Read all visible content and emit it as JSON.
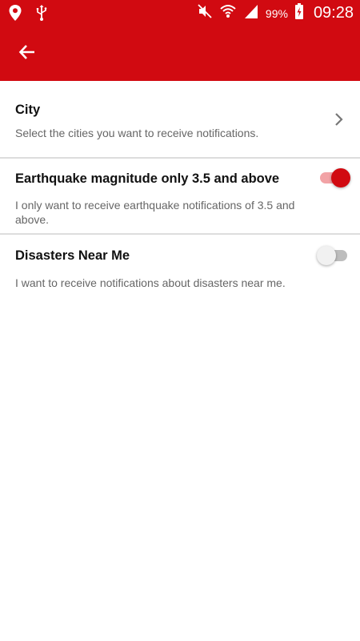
{
  "status_bar": {
    "battery_percent": "99%",
    "time": "09:28",
    "icons": [
      "location-icon",
      "usb-icon",
      "mute-icon",
      "wifi-icon",
      "signal-icon",
      "battery-charging-icon"
    ]
  },
  "app_bar": {
    "back_icon": "back-arrow-icon"
  },
  "settings": [
    {
      "title": "City",
      "summary": "Select the cities you want to receive notifications.",
      "control": "chevron-right-icon"
    },
    {
      "title": "Earthquake magnitude only 3.5 and above",
      "summary": "I only want to receive earthquake notifications of 3.5 and above.",
      "control": "switch",
      "enabled": true
    },
    {
      "title": "Disasters Near Me",
      "summary": "I want to receive notifications about disasters near me.",
      "control": "switch",
      "enabled": false
    }
  ],
  "colors": {
    "primary": "#d10a11",
    "switch_track_on": "#f2a3a6",
    "switch_track_off": "#bdbdbd",
    "switch_thumb_off": "#f1f1f1",
    "divider": "#dddddd"
  }
}
